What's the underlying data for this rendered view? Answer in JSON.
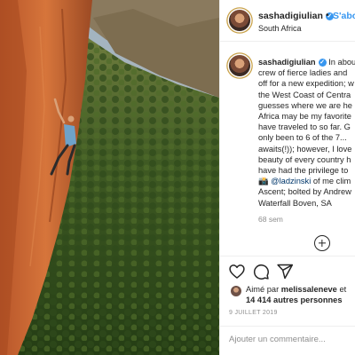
{
  "header": {
    "username": "sashadigiulian",
    "separator": "•",
    "follow_label": "S'abo",
    "location": "South Africa"
  },
  "caption": {
    "username": "sashadigiulian",
    "lines": [
      "In abou",
      "crew of fierce ladies and",
      "off for a new expedition; w",
      "the West Coast of Centra",
      "guesses where we are he",
      "Africa may be my favorite",
      "have traveled to so far. G",
      "only been to 6 of the 7...",
      "awaits(!)); however, I love",
      "beauty of every country h",
      "have had the privilege to"
    ],
    "photo_credit_icon": "📸",
    "mention": "@ladzinski",
    "line_after_mention": " of me clim",
    "line_ascent": "Ascent; bolted by Andrew",
    "line_waterfall": "Waterfall Boven, SA",
    "time": "68 sem"
  },
  "actions": {
    "icons": [
      "heart-icon",
      "comment-icon",
      "share-icon"
    ],
    "liked_by_prefix": "Aimé par ",
    "liked_by_user": "melissaleneve",
    "liked_by_joiner": " et",
    "others": "14 414 autres personnes",
    "date": "9 JUILLET 2019"
  },
  "comment": {
    "placeholder": "Ajouter un commentaire..."
  },
  "colors": {
    "link": "#3897f0",
    "verified": "#3897f0",
    "muted": "#8e8e8e",
    "text": "#262626"
  }
}
